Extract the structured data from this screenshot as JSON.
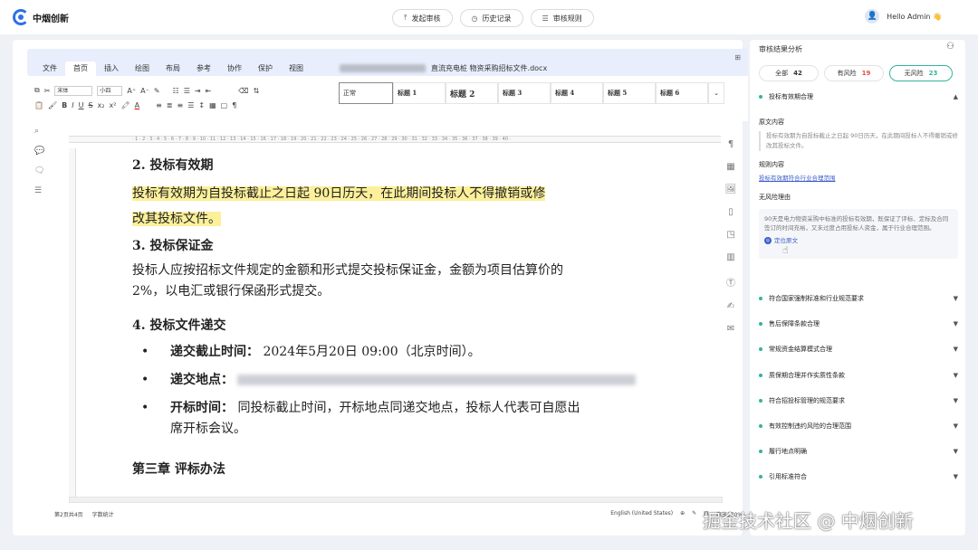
{
  "app": {
    "logo_text": "中烟创新"
  },
  "topnav": {
    "items": [
      {
        "icon": "upload-icon",
        "label": "发起审核"
      },
      {
        "icon": "clock-icon",
        "label": "历史记录"
      },
      {
        "icon": "list-icon",
        "label": "审核规则"
      }
    ]
  },
  "user": {
    "greeting": "Hello Admin 👋"
  },
  "editor": {
    "menu_tabs": [
      "文件",
      "首页",
      "插入",
      "绘图",
      "布局",
      "参考",
      "协作",
      "保护",
      "视图"
    ],
    "active_tab": "首页",
    "doc_title": "直流充电桩 物资采购招标文件.docx",
    "font_name": "宋体",
    "font_size": "小四",
    "styles": [
      "正常",
      "标题 1",
      "标题 2",
      "标题 3",
      "标题 4",
      "标题 5",
      "标题 6"
    ],
    "ruler_text": "· 1 · 2 · 3 · 4 · 5 · 6 · 7 · 8 · 9 · 10 · 11 · 12 · 13 · 14 · 15 · 16 · 17 · 18 · 19 · 20 · 21 · 22 · 23 · 24 · 25 · 26 · 27 · 28 · 29 · 30 · 31 · 32 · 33 · 34 · 35 · 36 · 37 · 38 · 39 · 40 ·",
    "status": {
      "page": "第2页共4页",
      "wordcount": "字数统计",
      "language": "English (United States)",
      "zoom": "缩放170%"
    }
  },
  "document": {
    "h2": "2.  投标有效期",
    "p2_line1": "投标有效期为自投标截止之日起 90日历天，在此期间投标人不得撤销或修",
    "p2_line2": "改其投标文件。",
    "h3": "3.  投标保证金",
    "p3_line1": "投标人应按招标文件规定的金额和形式提交投标保证金，金额为项目估算价的",
    "p3_line2": "2%，以电汇或银行保函形式提交。",
    "h4": "4.  投标文件递交",
    "b1_label": "递交截止时间：",
    "b1_value": "2024年5月20日  09:00（北京时间）。",
    "b2_label": "递交地点：",
    "b3_label": "开标时间：",
    "b3_line1": "同投标截止时间，开标地点同递交地点，投标人代表可自愿出",
    "b3_line2": "席开标会议。",
    "chapter": "第三章  评标办法"
  },
  "panel": {
    "title": "审核结果分析",
    "filters": [
      {
        "label": "全部",
        "count": "42",
        "color": "#333333"
      },
      {
        "label": "有风险",
        "count": "19",
        "color": "#e0524a"
      },
      {
        "label": "无风险",
        "count": "23",
        "color": "#35b39c"
      }
    ],
    "open_rule": {
      "title": "投标有效期合理",
      "original_heading": "原文内容",
      "original_text": "投标有效期为自投标截止之日起 90日历天，在此期间投标人不得撤销或修改其投标文件。",
      "rule_heading": "规则内容",
      "rule_text": "投标有效期符合行业合理范围",
      "reason_heading": "无风险理由",
      "reason_text": "90天是电力物资采购中标准的投标有效期，既保证了评标、定标及合同签订的时间充裕，又未过度占用投标人资金，属于行业合理范围。",
      "locate_label": "定位原文"
    },
    "rules": [
      "符合国家强制标准和行业规范要求",
      "售后保障条款合理",
      "常规资金结算模式合理",
      "质保期合理并作实质性条款",
      "符合招投标管理的规范要求",
      "有效控制违约风险的合理范围",
      "履行地点明确",
      "引用标准符合"
    ]
  },
  "watermark": "掘金技术社区 @ 中烟创新",
  "colors": {
    "accent": "#2f6fe8",
    "safe": "#35b39c",
    "risk": "#e0524a",
    "highlight": "#fcf09a"
  }
}
